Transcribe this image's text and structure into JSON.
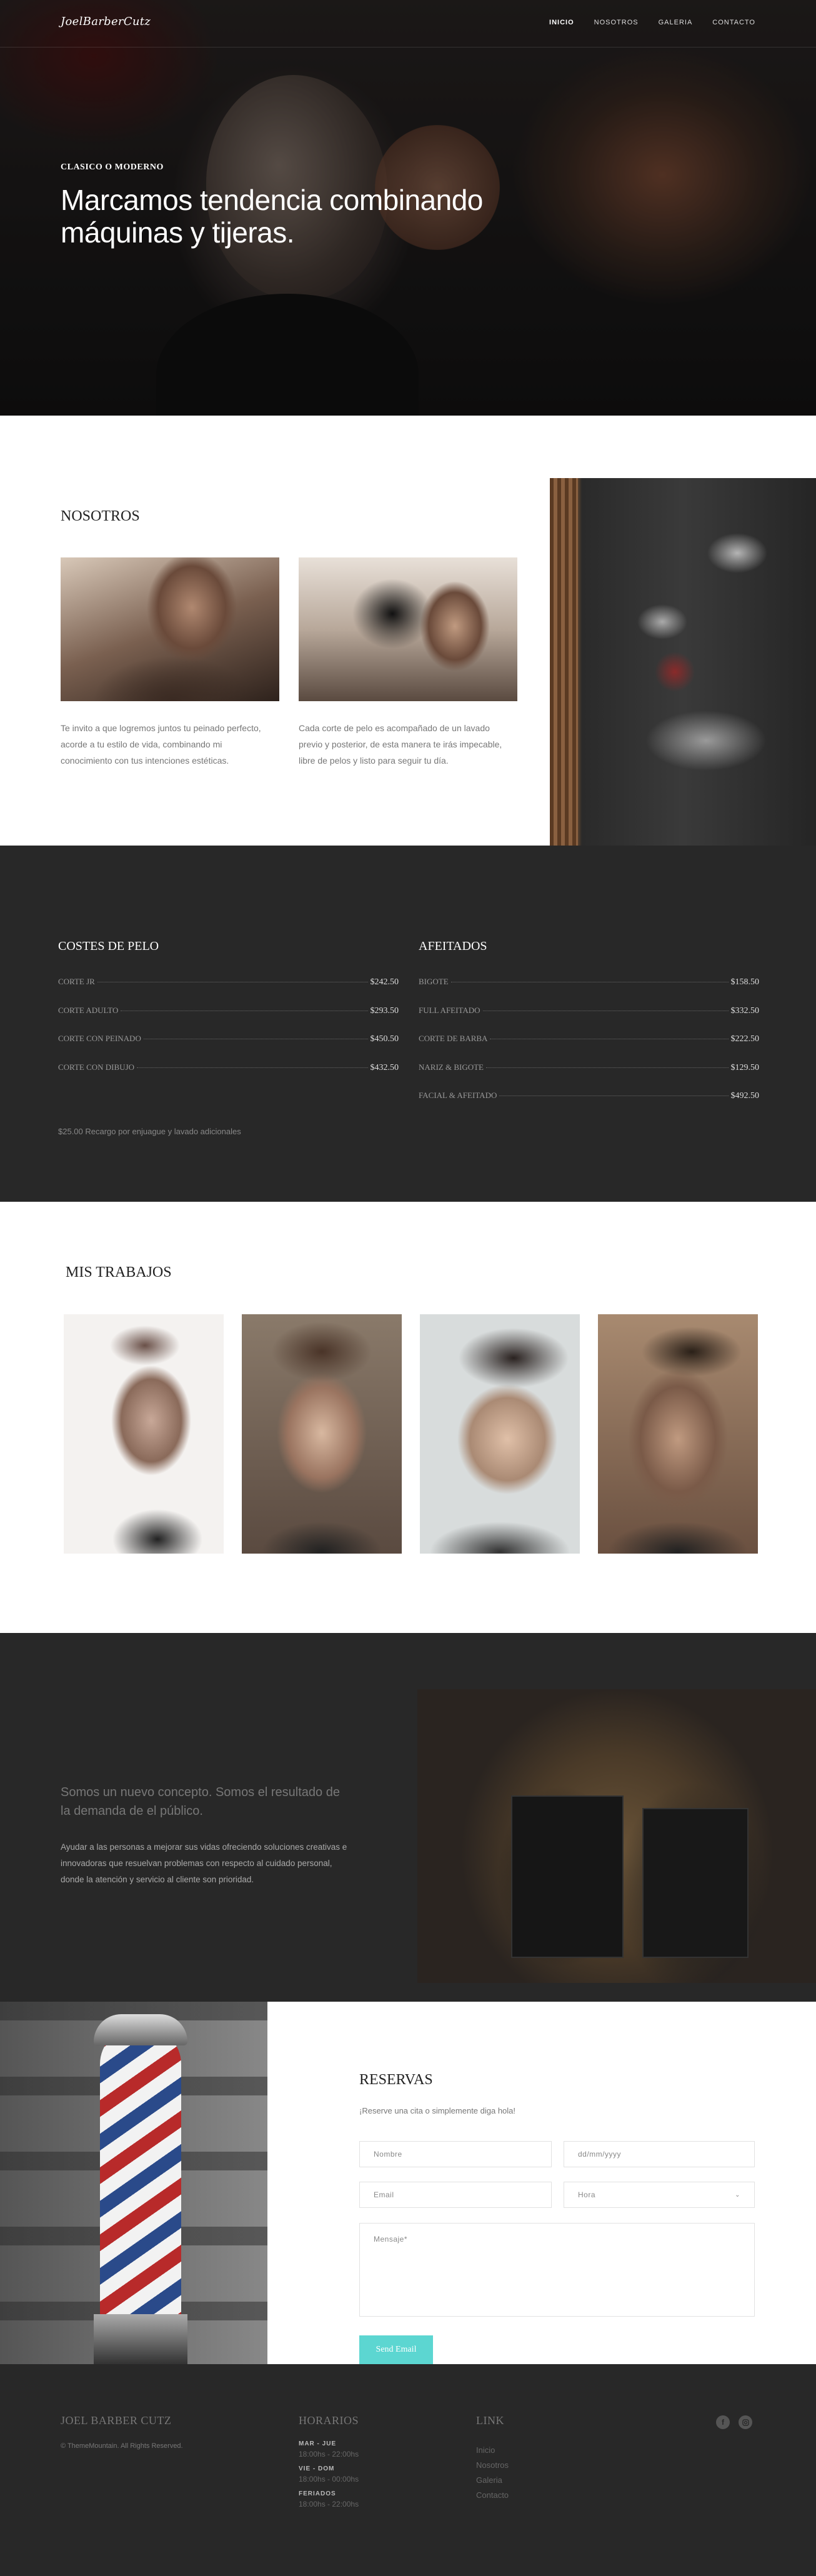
{
  "nav": {
    "logo": "JoelBarberCutz",
    "links": [
      "INICIO",
      "NOSOTROS",
      "GALERIA",
      "CONTACTO"
    ]
  },
  "hero": {
    "kicker": "CLASICO O MODERNO",
    "title": "Marcamos tendencia combinando máquinas y tijeras."
  },
  "about": {
    "title": "NOSOTROS",
    "text_1": "Te invito a que logremos juntos tu peinado perfecto, acorde a tu estilo de vida, combinando mi conocimiento con tus intenciones estéticas.",
    "text_2": "Cada corte de pelo es acompañado de un lavado previo y posterior, de esta manera te irás impecable, libre de pelos y listo para seguir tu día."
  },
  "prices": {
    "haircuts_title": "COSTES DE PELO",
    "haircuts": [
      {
        "name": "CORTE JR",
        "price": "$242.50"
      },
      {
        "name": "CORTE ADULTO",
        "price": "$293.50"
      },
      {
        "name": "CORTE CON PEINADO",
        "price": "$450.50"
      },
      {
        "name": "CORTE CON DIBUJO",
        "price": "$432.50"
      }
    ],
    "shaves_title": "AFEITADOS",
    "shaves": [
      {
        "name": "BIGOTE",
        "price": "$158.50"
      },
      {
        "name": "FULL AFEITADO",
        "price": "$332.50"
      },
      {
        "name": "CORTE DE BARBA",
        "price": "$222.50"
      },
      {
        "name": "NARIZ & BIGOTE",
        "price": "$129.50"
      },
      {
        "name": "FACIAL & AFEITADO",
        "price": "$492.50"
      }
    ],
    "note": "$25.00 Recargo por enjuague y lavado adicionales"
  },
  "gallery": {
    "title": "MIS TRABAJOS"
  },
  "concept": {
    "lead": "Somos un nuevo concepto. Somos el resultado de la demanda de el público.",
    "body": "Ayudar a las personas a mejorar sus vidas ofreciendo soluciones creativas e innovadoras que resuelvan problemas con respecto al cuidado personal, donde la atención y servicio al cliente son prioridad."
  },
  "reserve": {
    "title": "RESERVAS",
    "subtitle": "¡Reserve una cita o simplemente diga hola!",
    "name_placeholder": "Nombre",
    "date_placeholder": "dd/mm/yyyy",
    "email_placeholder": "Email",
    "hour_placeholder": "Hora",
    "message_placeholder": "Mensaje*",
    "button": "Send Email"
  },
  "footer": {
    "brand": "JOEL BARBER CUTZ",
    "copyright": "© ThemeMountain. All Rights Reserved.",
    "hours_title": "HORARIOS",
    "hours": [
      {
        "days": "MAR - JUE",
        "time": "18:00hs - 22:00hs"
      },
      {
        "days": "VIE - DOM",
        "time": "18:00hs - 00:00hs"
      },
      {
        "days": "FERIADOS",
        "time": "18:00hs - 22:00hs"
      }
    ],
    "links_title": "LINK",
    "links": [
      "Inicio",
      "Nosotros",
      "Galeria",
      "Contacto"
    ],
    "social": [
      "facebook-icon",
      "instagram-icon"
    ]
  },
  "colors": {
    "accent": "#5cd6d1",
    "dark_section": "#282828"
  }
}
